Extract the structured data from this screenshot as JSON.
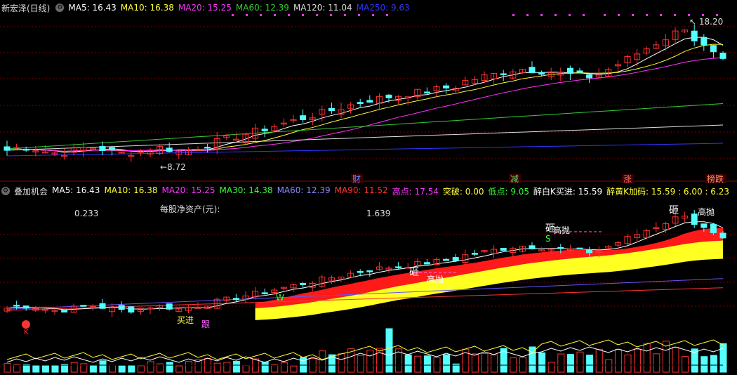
{
  "top_panel": {
    "title": "新宏泽(日线)",
    "ma": [
      {
        "label": "MA5: 16.43",
        "color": "#ffffff"
      },
      {
        "label": "MA10: 16.38",
        "color": "#ffff33"
      },
      {
        "label": "MA20: 15.25",
        "color": "#ff33ff"
      },
      {
        "label": "MA60: 12.39",
        "color": "#33cc33"
      },
      {
        "label": "MA120: 11.04",
        "color": "#dddddd"
      },
      {
        "label": "MA250: 9.63",
        "color": "#3333ff"
      }
    ],
    "high_label": "18.20",
    "low_label": "8.72",
    "tags": [
      {
        "text": "财",
        "color": "#6688ff"
      },
      {
        "text": "减",
        "color": "#66cc66"
      },
      {
        "text": "涨",
        "color": "#ff6666"
      },
      {
        "text": "榜跌",
        "color": "#ff8866"
      }
    ]
  },
  "bottom_panel": {
    "title": "叠加机会",
    "indicators": [
      {
        "label": "MA5: 16.43",
        "color": "#ffffff"
      },
      {
        "label": "MA10: 16.38",
        "color": "#ffff33"
      },
      {
        "label": "MA20: 15.25",
        "color": "#ff33ff"
      },
      {
        "label": "MA30: 14.38",
        "color": "#33ff33"
      },
      {
        "label": "MA60: 12.39",
        "color": "#8888ff"
      },
      {
        "label": "MA90: 11.52",
        "color": "#ff3333"
      },
      {
        "label": "高点: 17.54",
        "color": "#ff33ff"
      },
      {
        "label": "突破: 0.00",
        "color": "#ffff33"
      },
      {
        "label": "低点: 9.05",
        "color": "#33ff33"
      },
      {
        "label": "醉白K买进: 15.59",
        "color": "#ffffff"
      },
      {
        "label": "醉黄K加码: 15.59 : 6.00 : 6.23",
        "color": "#ffff33"
      }
    ],
    "eps_left": "0.233",
    "eps_title": "每股净资产(元):",
    "eps_right": "1.639",
    "signals": {
      "buy": "买进",
      "follow": "跟",
      "high_throw": "高抛",
      "smash": "砸",
      "w": "W",
      "s": "S",
      "k": "K"
    }
  },
  "colors": {
    "up": "#ff3232",
    "down": "#54ffff",
    "grid": "#7a0000"
  }
}
